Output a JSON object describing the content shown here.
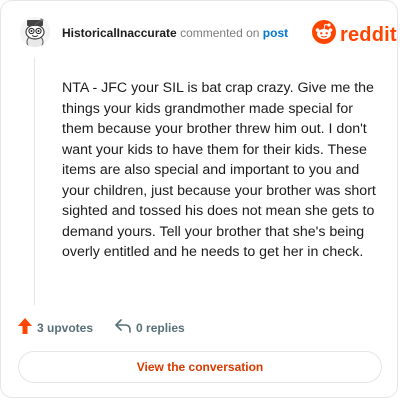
{
  "header": {
    "username": "HistoricalInaccurate",
    "action_text": "commented on",
    "post_link": "post",
    "brand": "reddit"
  },
  "comment": {
    "body": "NTA - JFC your SIL is bat crap crazy. Give me the things your kids grandmother made special for them because your brother threw him out. I don't want your kids to have them for their kids. These items are also special and important to you and your children, just because your brother was short sighted and tossed his does not mean she gets to demand yours. Tell your brother that she's being overly entitled and he needs to get her in check."
  },
  "actions": {
    "upvotes": "3 upvotes",
    "replies": "0 replies"
  },
  "cta": {
    "label": "View the conversation"
  },
  "icons": {
    "avatar": "snoo-avatar-icon",
    "logo": "reddit-snoo-icon",
    "upvote": "upvote-arrow-icon",
    "reply": "reply-arrow-icon"
  },
  "colors": {
    "brand": "#ff4500",
    "link": "#0079d3",
    "cta_text": "#d93a00",
    "muted": "#576f76"
  }
}
